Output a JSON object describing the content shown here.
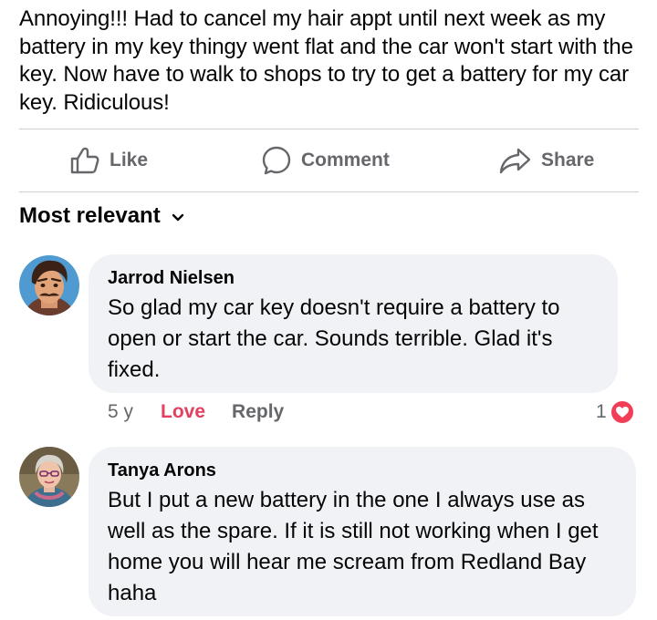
{
  "post": {
    "text": "Annoying!!! Had to cancel my hair appt until next week as my battery in my key thingy went flat and the car won't start with the key.  Now have to walk to shops to try to get a battery for my car key.  Ridiculous!"
  },
  "actions": {
    "like_label": "Like",
    "comment_label": "Comment",
    "share_label": "Share"
  },
  "comments_sort": {
    "label": "Most relevant"
  },
  "comments": [
    {
      "author": "Jarrod Nielsen",
      "text": "So glad my car key doesn't require a battery to open or start the car.  Sounds terrible. Glad it's fixed.",
      "time": "5 y",
      "reaction_label": "Love",
      "reply_label": "Reply",
      "reaction_count": "1",
      "reaction_icon": "heart-icon"
    },
    {
      "author": "Tanya Arons",
      "text": "But I put a new battery in the one I always use as well as the spare.  If it is still not working when I get home you will hear me scream from Redland Bay haha"
    }
  ],
  "colors": {
    "secondary_text": "#65676b",
    "love": "#e4405f",
    "bubble": "#f0f2f5",
    "heart_badge": "#f33e58"
  }
}
